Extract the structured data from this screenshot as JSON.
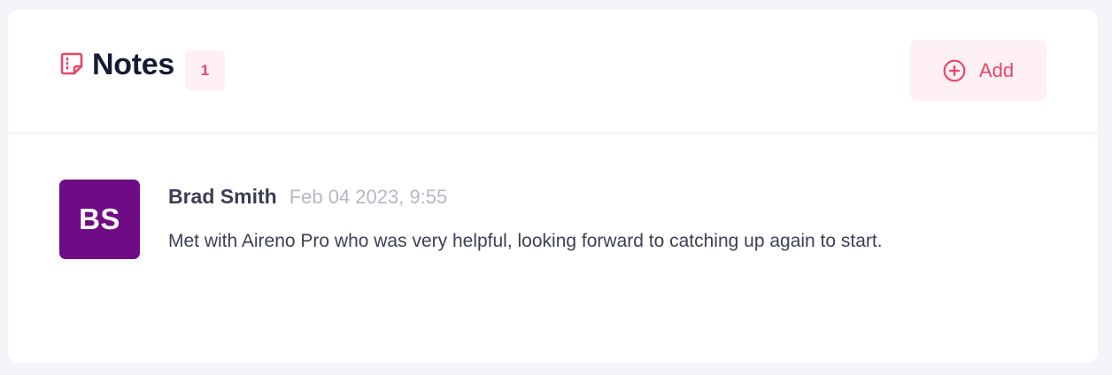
{
  "notes_card": {
    "title": "Notes",
    "count": "1",
    "title_icon": "sticky-note-icon",
    "add_icon": "plus-circle-icon",
    "add_label": "Add"
  },
  "notes": [
    {
      "avatar_initials": "BS",
      "author": "Brad Smith",
      "timestamp": "Feb 04 2023, 9:55",
      "body": "Met with Aireno Pro who was very helpful, looking forward to catching up again to start."
    }
  ],
  "colors": {
    "accent": "#e8456a",
    "accent_bg": "#fff0f3",
    "avatar_bg": "#6f0b85",
    "title": "#161a33",
    "muted": "#b5b8c5",
    "page_bg": "#f4f5f8"
  }
}
